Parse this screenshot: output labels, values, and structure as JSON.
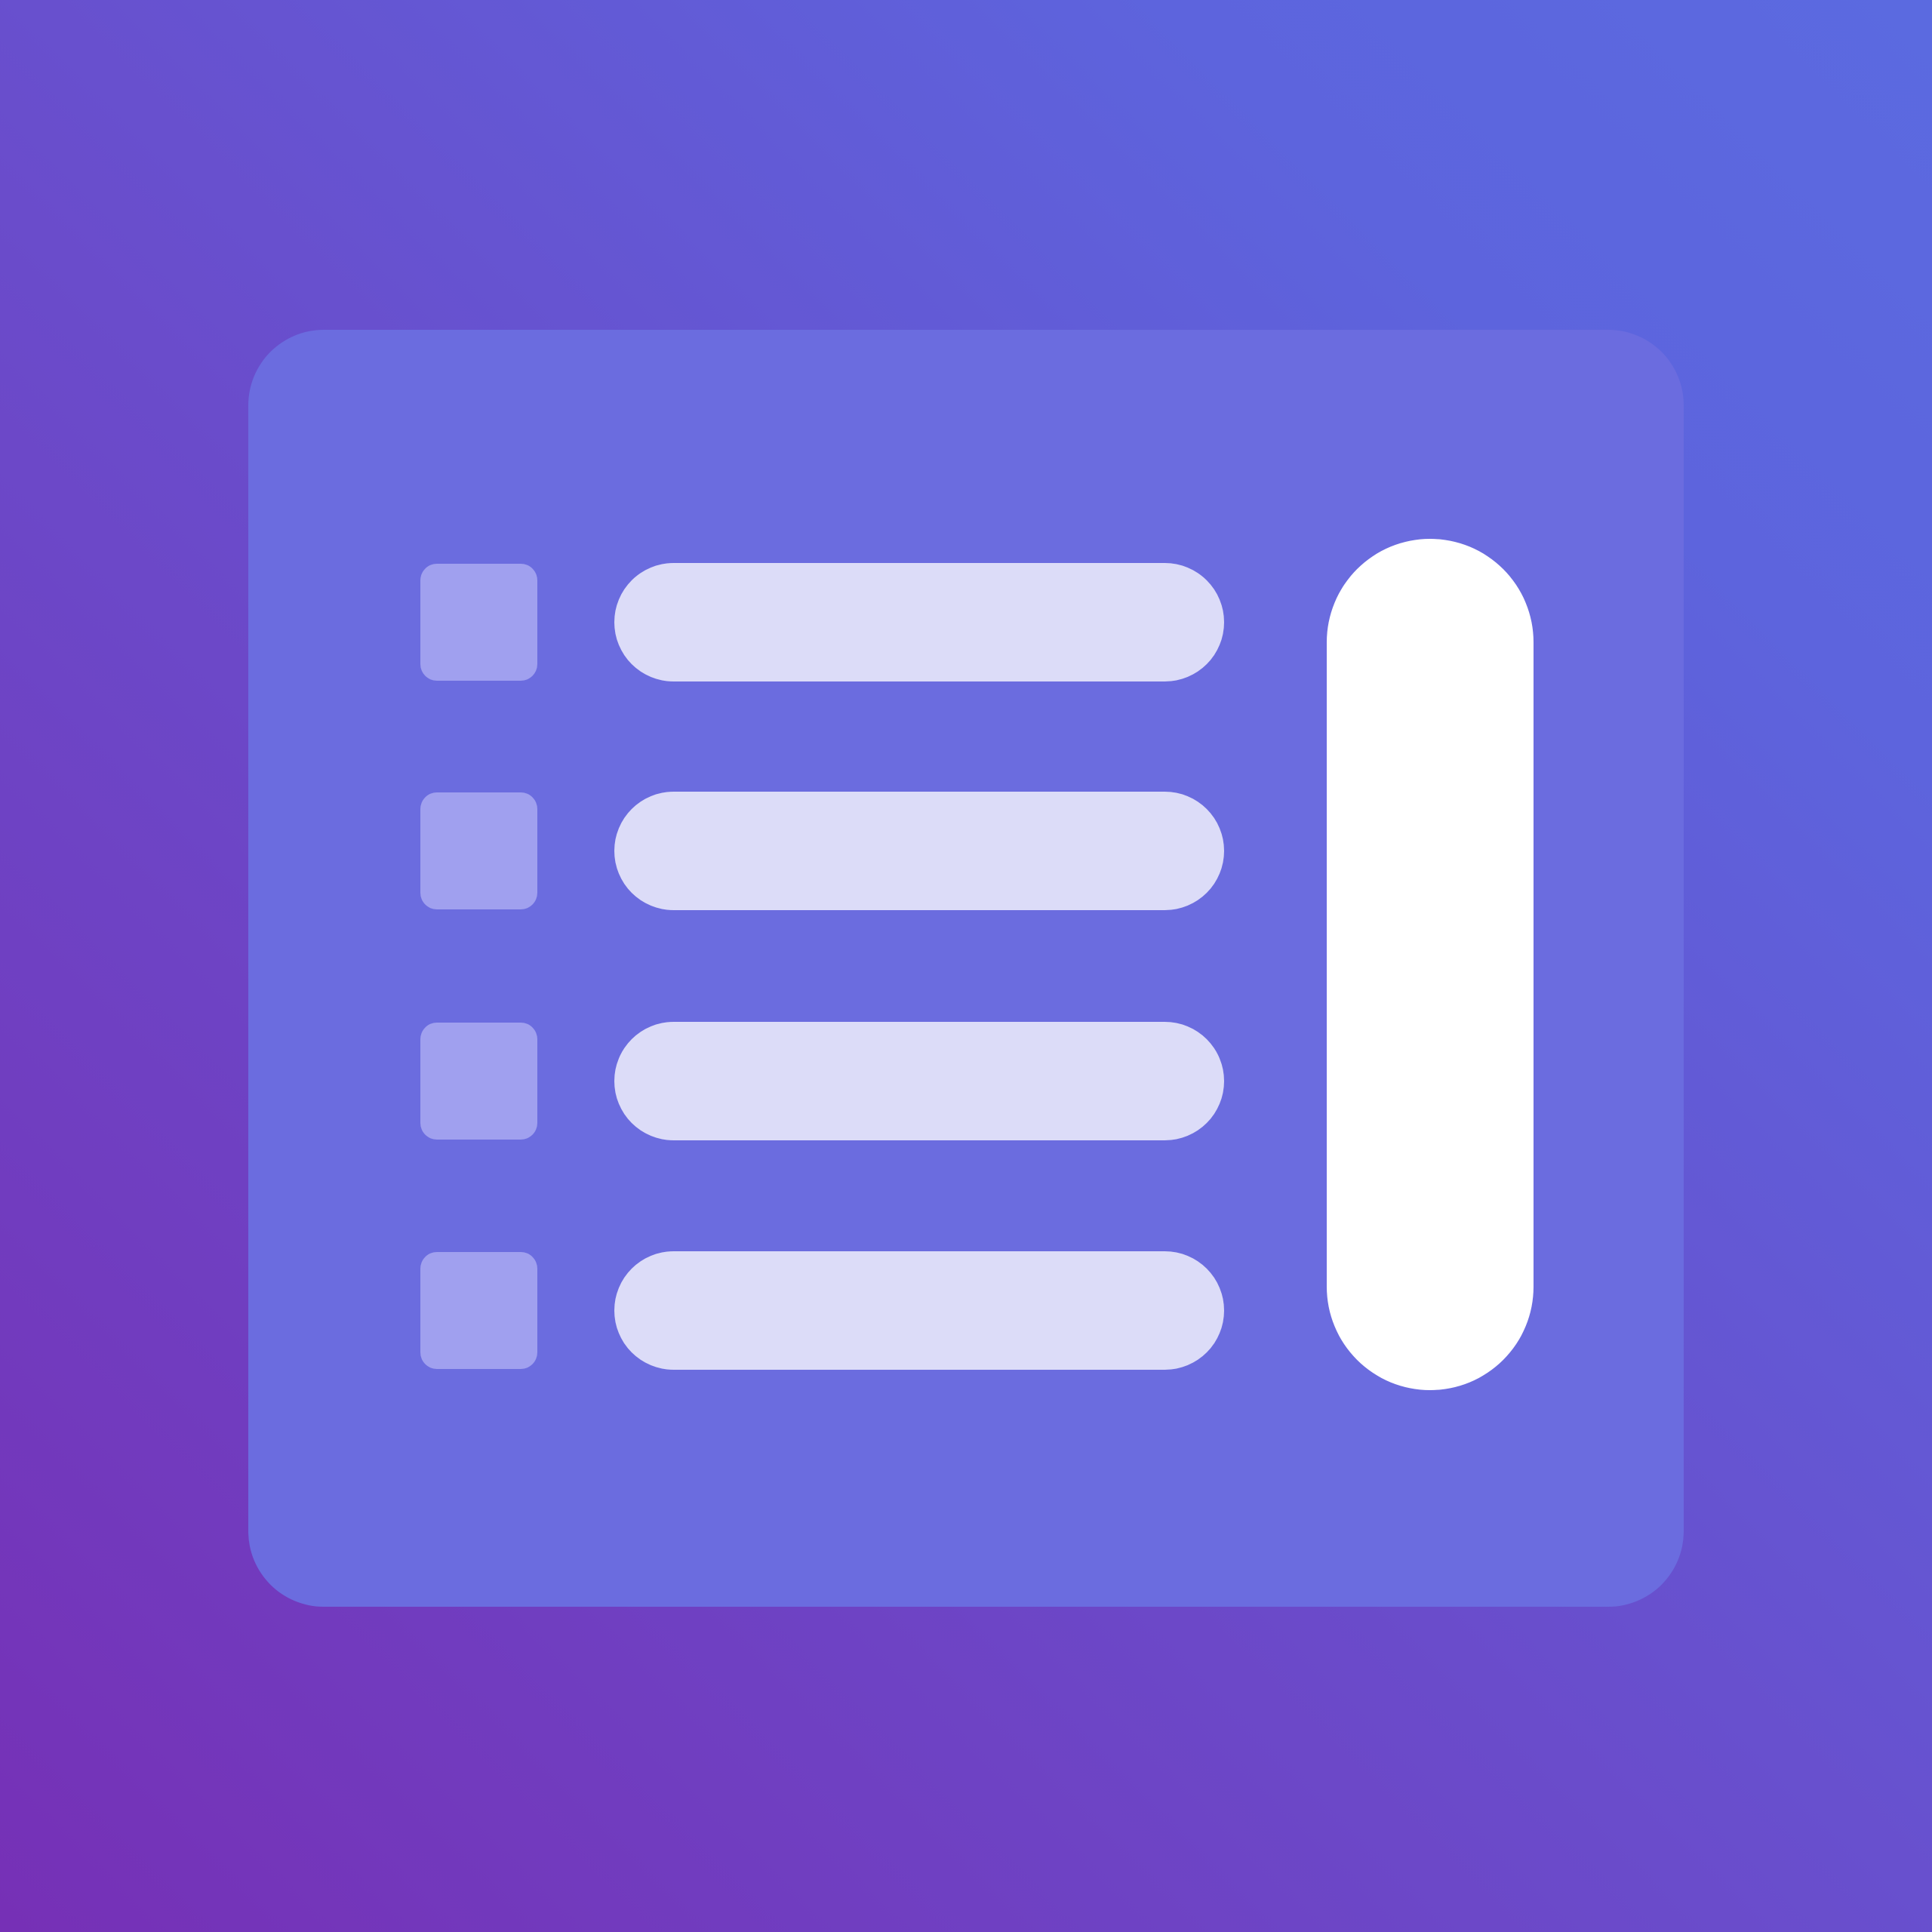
{
  "colors": {
    "background_gradient": [
      "#7630b6",
      "#6a4ccb",
      "#5d64dd",
      "#5b6ae0"
    ],
    "card": "#6b6cdf",
    "bullet": "#a0a0ef",
    "bar": "#dcdcf8",
    "scrollbar": "#ffffff"
  },
  "icon": {
    "name": "list-with-scrollbar-icon"
  },
  "list": {
    "items": [
      {
        "bullet_icon": "square-bullet-icon"
      },
      {
        "bullet_icon": "square-bullet-icon"
      },
      {
        "bullet_icon": "square-bullet-icon"
      },
      {
        "bullet_icon": "square-bullet-icon"
      }
    ]
  },
  "scrollbar": {
    "icon": "scrollbar-thumb-icon"
  }
}
